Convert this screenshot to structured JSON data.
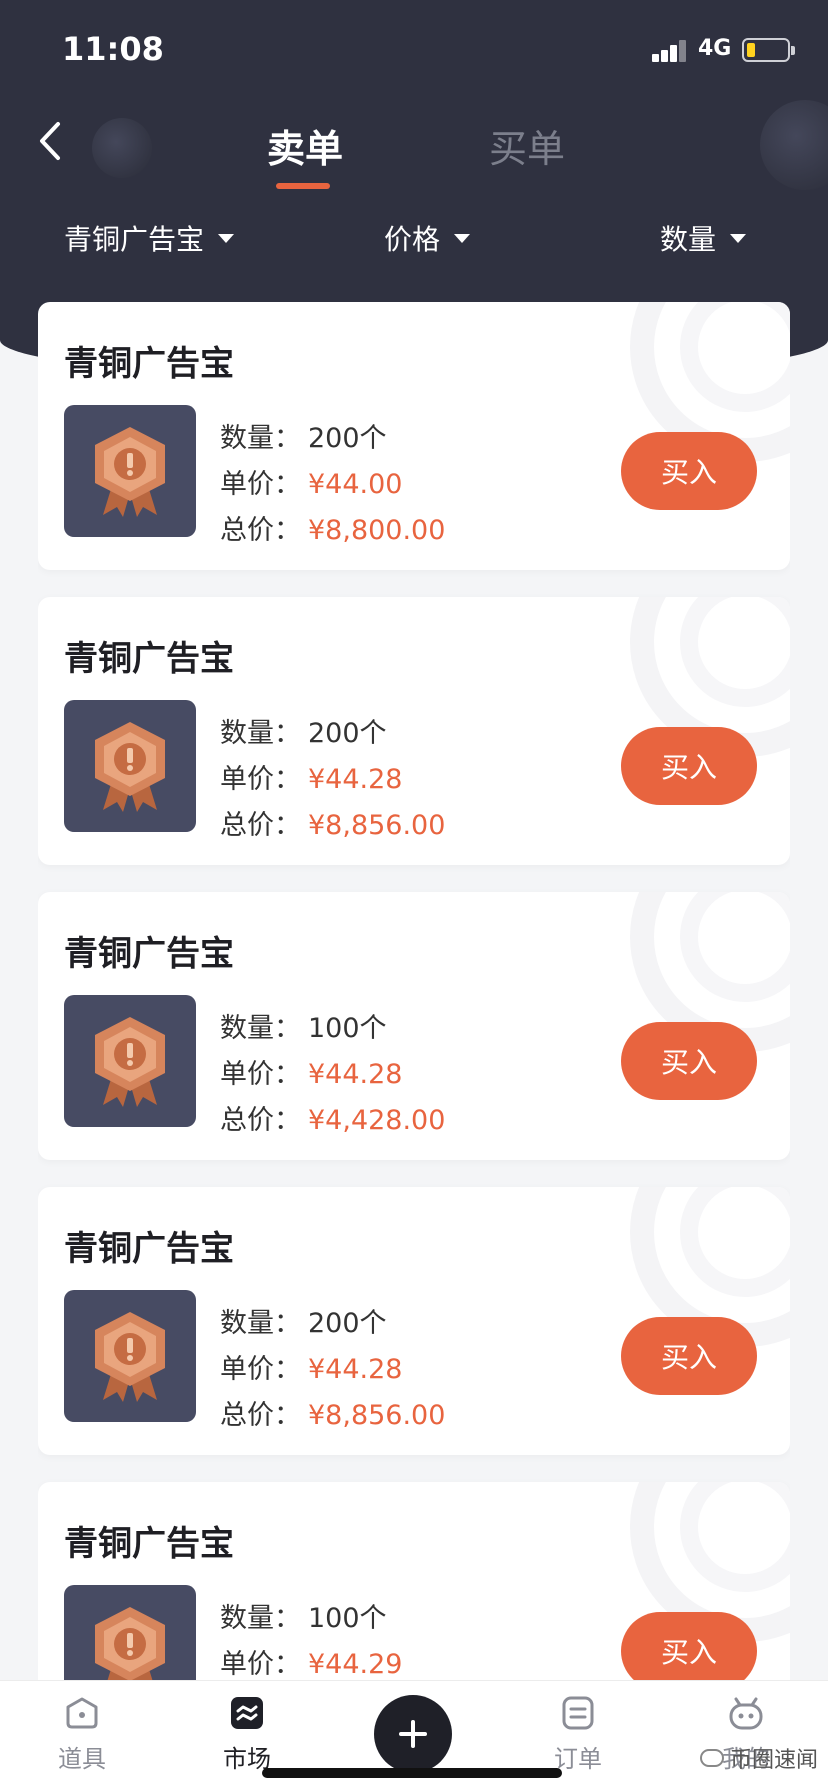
{
  "status_bar": {
    "time": "11:08",
    "network": "4G"
  },
  "header": {
    "tabs": [
      {
        "label": "卖单",
        "active": true
      },
      {
        "label": "买单",
        "active": false
      }
    ],
    "filters": [
      {
        "label": "青铜广告宝"
      },
      {
        "label": "价格"
      },
      {
        "label": "数量"
      }
    ]
  },
  "colors": {
    "accent": "#e8643f",
    "header_bg": "#2f3140",
    "badge_bg": "#474b63"
  },
  "labels": {
    "quantity": "数量：",
    "unit_price": "单价：",
    "total_price": "总价："
  },
  "orders": [
    {
      "title": "青铜广告宝",
      "quantity": "200个",
      "unit_price": "¥44.00",
      "total_price": "¥8,800.00",
      "button": "买入"
    },
    {
      "title": "青铜广告宝",
      "quantity": "200个",
      "unit_price": "¥44.28",
      "total_price": "¥8,856.00",
      "button": "买入"
    },
    {
      "title": "青铜广告宝",
      "quantity": "100个",
      "unit_price": "¥44.28",
      "total_price": "¥4,428.00",
      "button": "买入"
    },
    {
      "title": "青铜广告宝",
      "quantity": "200个",
      "unit_price": "¥44.28",
      "total_price": "¥8,856.00",
      "button": "买入"
    },
    {
      "title": "青铜广告宝",
      "quantity": "100个",
      "unit_price": "¥44.29",
      "total_price": "",
      "button": "买入"
    }
  ],
  "tabbar": {
    "items": [
      {
        "label": "道具",
        "icon": "box-icon"
      },
      {
        "label": "市场",
        "icon": "market-icon"
      },
      {
        "label": "订单",
        "icon": "order-icon"
      },
      {
        "label": "我的",
        "icon": "robot-face-icon"
      }
    ]
  },
  "watermark": "币圈速闻"
}
